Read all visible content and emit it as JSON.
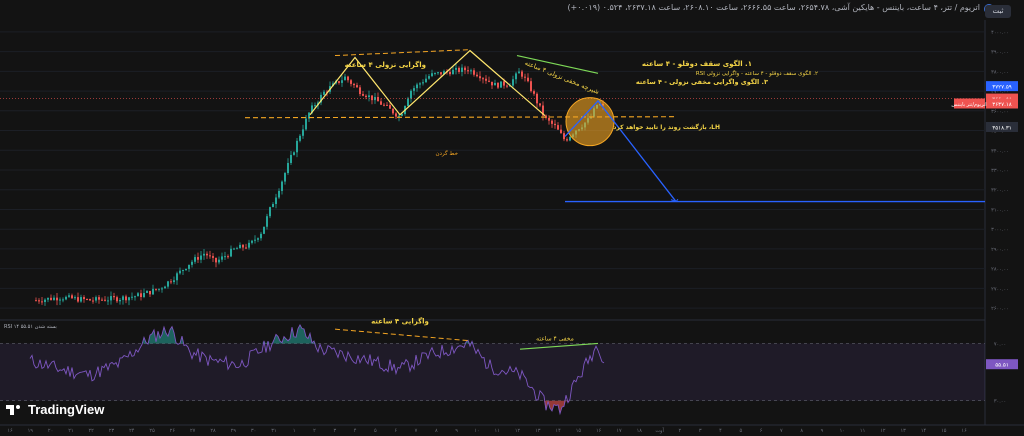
{
  "header": {
    "title": "اتریوم / تتر، ۴ ساعت، بایننس - هایکین آشی، ۲۶۵۴.۷۸، ساعت ۲۶۶۶.۵۵، ساعت ۲۶۰۸.۱۰، ساعت ۲۶۳۷.۱۸، ۰.۵۲۴ (۰.۰۱۹+)",
    "login_label": "ثبت"
  },
  "colors": {
    "bull": "#26a69a",
    "bear": "#ef5350",
    "background": "#131313",
    "rsi_line": "#7e57c2"
  },
  "chart_data": [
    {
      "type": "candlestick",
      "x_dates": [
        "۱۶",
        "۱۹",
        "۲۰",
        "۲۱",
        "۲۲",
        "۲۳",
        "۲۴",
        "۲۵",
        "۲۶",
        "۲۷",
        "۲۸",
        "۲۹",
        "۳۰",
        "۳۱",
        "۱",
        "۲",
        "۳",
        "۴",
        "۵",
        "۶",
        "۷",
        "۸",
        "۹",
        "۱۰",
        "۱۱",
        "۱۲",
        "۱۳",
        "۱۴",
        "۱۵",
        "۱۶",
        "۱۷",
        "۱۸",
        "آوت",
        "۲",
        "۳",
        "۴",
        "۵",
        "۶",
        "۷",
        "۸",
        "۹",
        "۱۰",
        "۱۱",
        "۱۲",
        "۱۳",
        "۱۴",
        "۱۵",
        "۱۶"
      ],
      "y_ticks": [
        "۴۰۰۰.۰۰",
        "۳۹۰۰.۰۰",
        "۳۸۰۰.۰۰",
        "۳۷۰۰.۰۰",
        "۳۶۰۰.۰۰",
        "۳۵۰۰.۰۰",
        "۳۴۰۰.۰۰",
        "۳۳۰۰.۰۰",
        "۳۲۰۰.۰۰",
        "۳۱۰۰.۰۰",
        "۳۰۰۰.۰۰",
        "۲۹۰۰.۰۰",
        "۲۸۰۰.۰۰",
        "۲۷۰۰.۰۰",
        "۲۶۰۰.۰۰"
      ],
      "y_range": [
        2550,
        4050
      ],
      "price_labels": [
        {
          "text": "۳۷۲۷.۵۹",
          "value": 3725,
          "color": "#2962ff"
        },
        {
          "text": "۳۶۶۰.۵۸",
          "value": 3662,
          "color": "#ef5350"
        },
        {
          "text": "۳۶۳۷.۱۸",
          "value": 3637,
          "color": "#ef5350"
        },
        {
          "text": "۳۵۱۸.۳۱",
          "value": 3518,
          "color": "#2a2e39"
        }
      ],
      "series_label": "اتریوم/تتر بایننس",
      "annotations": {
        "double_top": "۱. الگوی سقف دوقلو - ۴ ساعته",
        "rsi_div": "۲. الگوی سقف دوقلو - ۴ ساعته - واگرایی نزولی RSI",
        "hidden_div": "۳. الگوی واگرایی مخفی نزولی - ۴ ساعته",
        "bear_div_4h": "واگرایی نزولی ۴ ساعته",
        "bear_channel": "شیرچه مخفی نزولی ۴ ساعته",
        "neckline": "خط گردن",
        "lh_note": "LH، بازگشت روند را تایید خواهد کرد"
      }
    },
    {
      "type": "line",
      "name": "RSI",
      "indicator_label": "RSI ۱۴ بسته شدن ۵۵.۵۱",
      "value_label": "۵۵.۵۱",
      "y_range": [
        20,
        85
      ],
      "y_ticks": [
        "۷۰.۰۰",
        "۳۰.۰۰"
      ],
      "annotations": {
        "rsi_div": "واگرایی ۴ ساعته",
        "hidden": "مخفی ۴ ساعته"
      }
    }
  ],
  "watermark": "TradingView"
}
